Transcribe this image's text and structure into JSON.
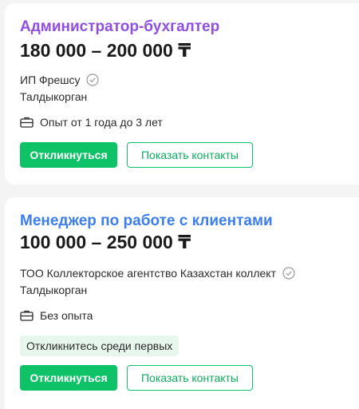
{
  "colors": {
    "title_purple": "#8f4fe0",
    "title_blue": "#3c7ef0",
    "accent_green": "#0dc267",
    "badge_bg": "#e8f7ee"
  },
  "vacancies": [
    {
      "title": "Администратор-бухгалтер",
      "salary": "180 000 – 200 000 ₸",
      "company": "ИП Фрешсу",
      "verified_icon": "check-circle-icon",
      "city": "Талдыкорган",
      "experience_icon": "briefcase-icon",
      "experience": "Опыт от 1 года до 3 лет",
      "apply_label": "Откликнуться",
      "contacts_label": "Показать контакты"
    },
    {
      "title": "Менеджер по работе с клиентами",
      "salary": "100 000 – 250 000 ₸",
      "company": "ТОО Коллекторское агентство Казахстан коллект",
      "verified_icon": "check-circle-icon",
      "city": "Талдыкорган",
      "experience_icon": "briefcase-icon",
      "experience": "Без опыта",
      "badge": "Откликнитесь среди первых",
      "apply_label": "Откликнуться",
      "contacts_label": "Показать контакты"
    }
  ]
}
